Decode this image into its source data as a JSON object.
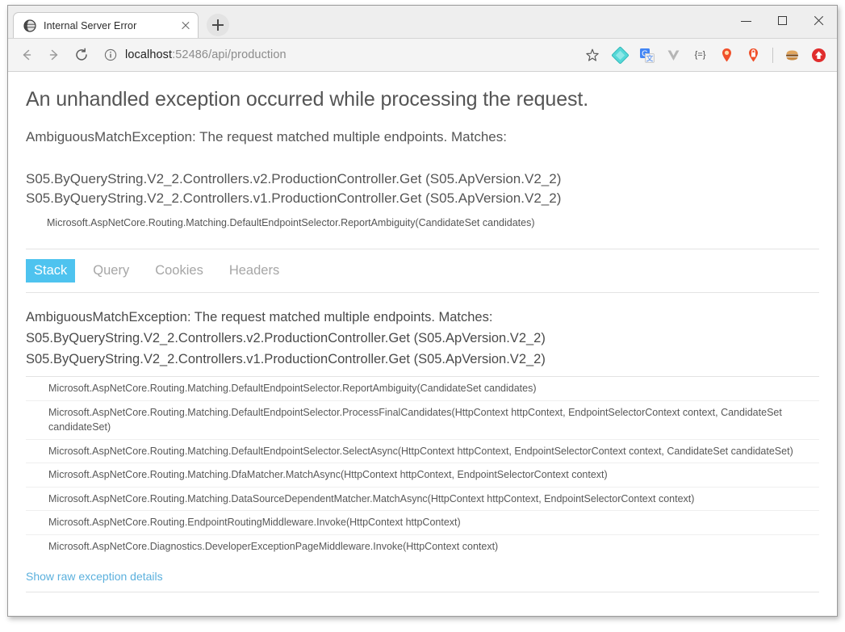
{
  "window": {
    "controls": {
      "minimize": "minimize-button",
      "maximize": "maximize-button",
      "close": "close-button"
    }
  },
  "browser": {
    "tab": {
      "title": "Internal Server Error",
      "favicon": "globe-icon",
      "close_label": "close-tab"
    },
    "new_tab_label": "new-tab",
    "nav": {
      "back": "back-arrow-icon",
      "forward": "forward-arrow-icon",
      "reload": "reload-icon"
    },
    "address": {
      "info_icon": "info-circle-icon",
      "host": "localhost",
      "path": ":52486/api/production",
      "full_url": "localhost:52486/api/production"
    },
    "extensions": [
      {
        "name": "bookmark-star-icon",
        "glyph": "☆",
        "color": "#5a5a5a"
      },
      {
        "name": "diamond-extension-icon",
        "glyph": "",
        "color": "#55d8d8"
      },
      {
        "name": "google-translate-icon",
        "glyph": "",
        "color": "#4285f4"
      },
      {
        "name": "vimium-extension-icon",
        "glyph": "",
        "color": "#b0b0b0"
      },
      {
        "name": "regex-extension-icon",
        "glyph": "{=}",
        "color": "#4a4a4a"
      },
      {
        "name": "location-pin-icon",
        "glyph": "",
        "color": "#f04a28"
      },
      {
        "name": "lock-extension-icon",
        "glyph": "",
        "color": "#f04a28"
      },
      {
        "name": "hamburger-extension-icon",
        "glyph": "",
        "color": "#b07a42"
      },
      {
        "name": "upload-arrow-icon",
        "glyph": "",
        "color": "#e03030"
      }
    ]
  },
  "page": {
    "heading": "An unhandled exception occurred while processing the request.",
    "exception_line": "AmbiguousMatchException: The request matched multiple endpoints. Matches:",
    "match_lines": [
      "S05.ByQueryString.V2_2.Controllers.v2.ProductionController.Get (S05.ApVersion.V2_2)",
      "S05.ByQueryString.V2_2.Controllers.v1.ProductionController.Get (S05.ApVersion.V2_2)"
    ],
    "top_frame": "Microsoft.AspNetCore.Routing.Matching.DefaultEndpointSelector.ReportAmbiguity(CandidateSet candidates)",
    "tabs": [
      {
        "label": "Stack",
        "active": true
      },
      {
        "label": "Query",
        "active": false
      },
      {
        "label": "Cookies",
        "active": false
      },
      {
        "label": "Headers",
        "active": false
      }
    ],
    "stack_summary": [
      "AmbiguousMatchException: The request matched multiple endpoints. Matches:",
      "S05.ByQueryString.V2_2.Controllers.v2.ProductionController.Get (S05.ApVersion.V2_2)",
      "S05.ByQueryString.V2_2.Controllers.v1.ProductionController.Get (S05.ApVersion.V2_2)"
    ],
    "frames": [
      "Microsoft.AspNetCore.Routing.Matching.DefaultEndpointSelector.ReportAmbiguity(CandidateSet candidates)",
      "Microsoft.AspNetCore.Routing.Matching.DefaultEndpointSelector.ProcessFinalCandidates(HttpContext httpContext, EndpointSelectorContext context, CandidateSet candidateSet)",
      "Microsoft.AspNetCore.Routing.Matching.DefaultEndpointSelector.SelectAsync(HttpContext httpContext, EndpointSelectorContext context, CandidateSet candidateSet)",
      "Microsoft.AspNetCore.Routing.Matching.DfaMatcher.MatchAsync(HttpContext httpContext, EndpointSelectorContext context)",
      "Microsoft.AspNetCore.Routing.Matching.DataSourceDependentMatcher.MatchAsync(HttpContext httpContext, EndpointSelectorContext context)",
      "Microsoft.AspNetCore.Routing.EndpointRoutingMiddleware.Invoke(HttpContext httpContext)",
      "Microsoft.AspNetCore.Diagnostics.DeveloperExceptionPageMiddleware.Invoke(HttpContext context)"
    ],
    "raw_link": "Show raw exception details"
  },
  "colors": {
    "tab_active_bg": "#4ec3ef",
    "link": "#5bb0dd",
    "text": "#555555"
  }
}
